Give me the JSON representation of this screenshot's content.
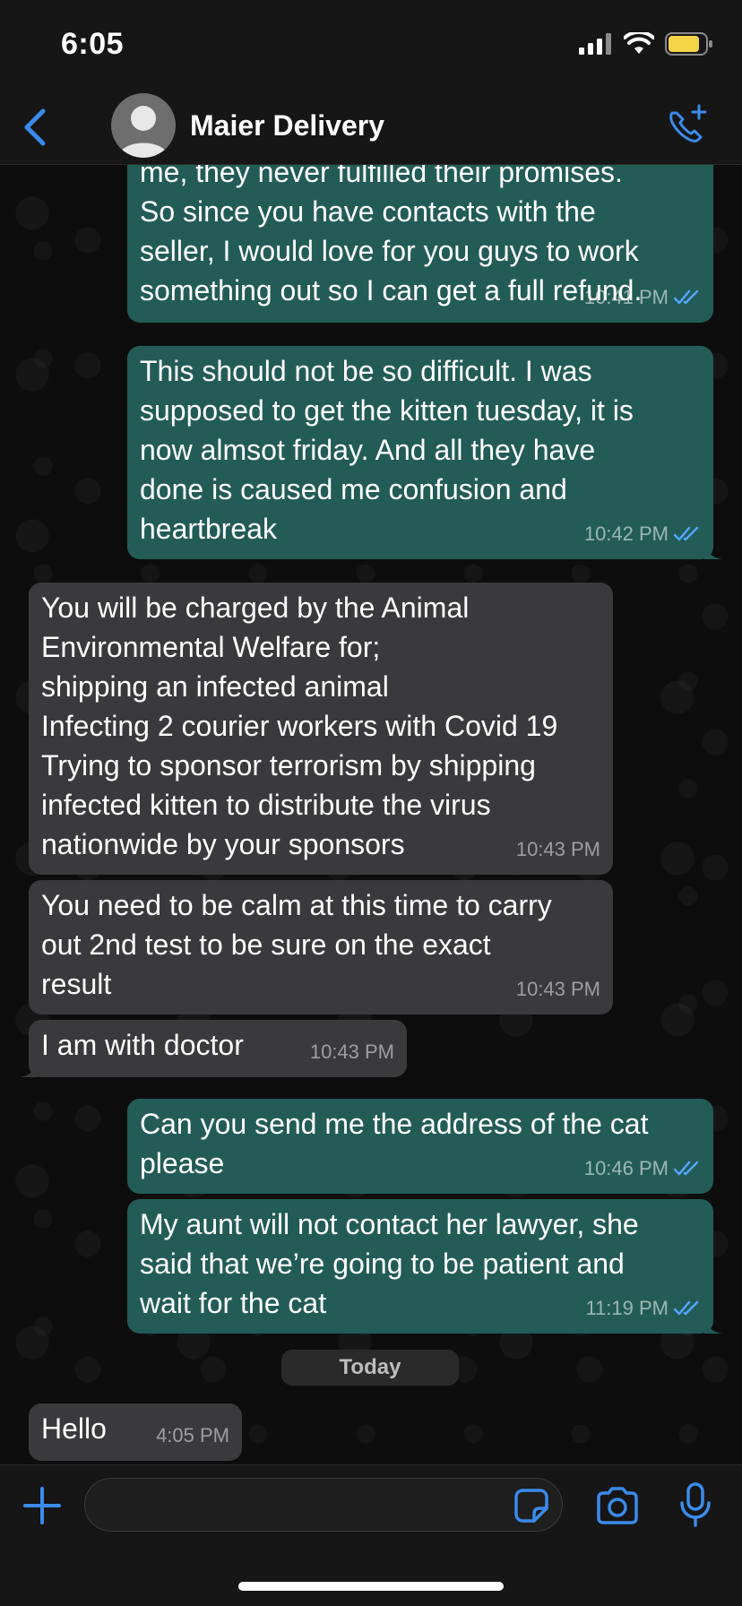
{
  "status_bar": {
    "time": "6:05"
  },
  "header": {
    "contact_name": "Maier Delivery"
  },
  "messages": [
    {
      "direction": "outgoing",
      "text": "me, they never fulfilled their promises.\nSo since you have contacts with the\nseller, I would love for you guys to work\nsomething out so I can get a full refund.",
      "time": "10:41 PM",
      "read": true
    },
    {
      "direction": "outgoing",
      "text": "This should not be so difficult. I was\nsupposed to get the kitten tuesday, it is\nnow almsot friday. And all they have\ndone is caused me confusion and\nheartbreak",
      "time": "10:42 PM",
      "read": true
    },
    {
      "direction": "incoming",
      "text": "You will be charged by the Animal\nEnvironmental Welfare for;\nshipping an infected animal\nInfecting 2 courier workers with Covid 19\nTrying to sponsor terrorism by shipping\ninfected kitten to distribute the virus\nnationwide by your sponsors",
      "time": "10:43 PM"
    },
    {
      "direction": "incoming",
      "text": "You need to be calm at this time to carry\nout 2nd test to be sure on the exact\nresult",
      "time": "10:43 PM"
    },
    {
      "direction": "incoming",
      "text": "I am with doctor",
      "time": "10:43 PM"
    },
    {
      "direction": "outgoing",
      "text": "Can you send me the address of the cat\nplease",
      "time": "10:46 PM",
      "read": true
    },
    {
      "direction": "outgoing",
      "text": "My aunt will not contact her lawyer, she\nsaid that we’re going to be patient and\nwait for the cat",
      "time": "11:19 PM",
      "read": true
    },
    {
      "direction": "incoming",
      "text": "Hello",
      "time": "4:05 PM"
    }
  ],
  "date_separator": "Today",
  "composer": {
    "placeholder": ""
  },
  "colors": {
    "accent": "#3b8beb",
    "outgoing_bubble": "#235c57",
    "incoming_bubble": "#3a3a3c",
    "read_check": "#53a6fd"
  },
  "icons": [
    "back-chevron-icon",
    "avatar-placeholder-icon",
    "add-call-icon",
    "plus-icon",
    "sticker-icon",
    "camera-icon",
    "microphone-icon"
  ]
}
